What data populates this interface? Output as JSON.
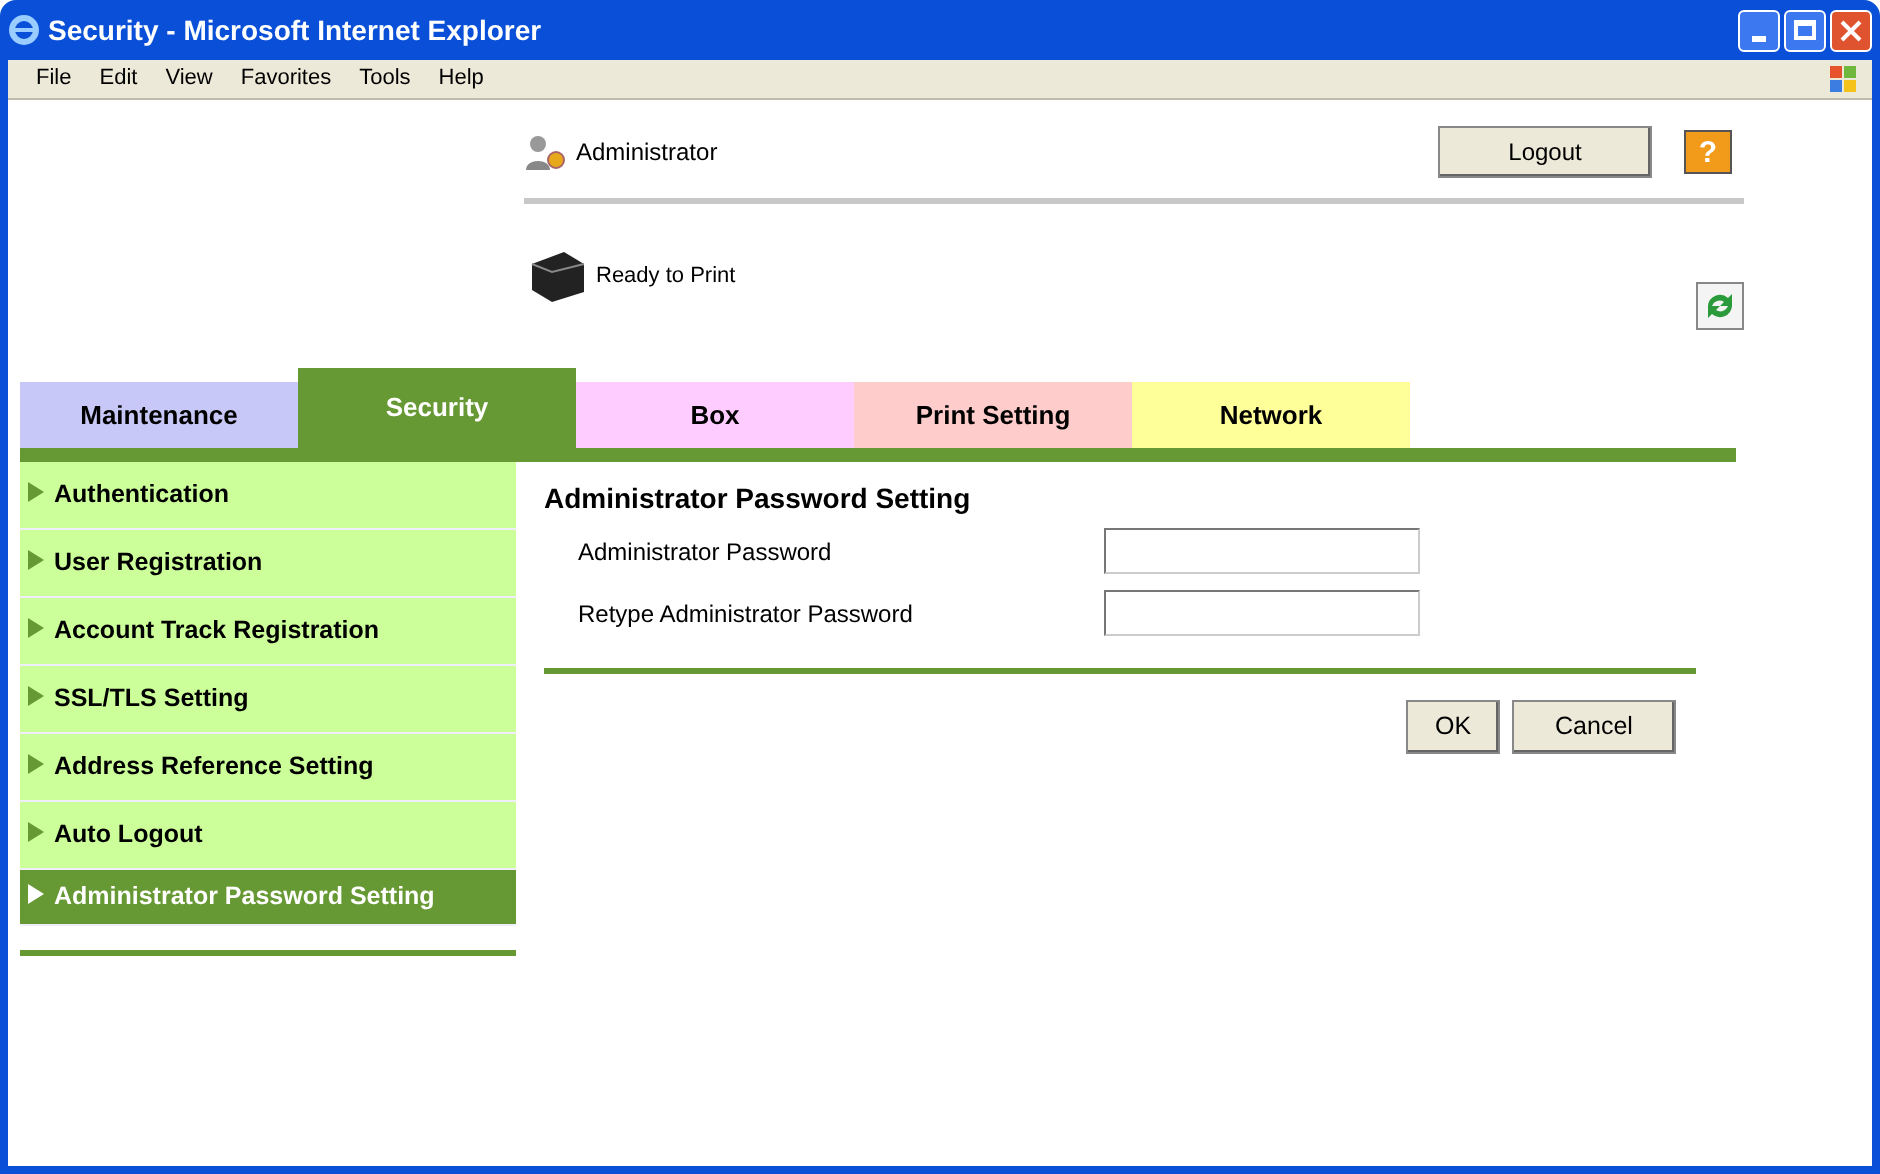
{
  "window": {
    "title": "Security - Microsoft Internet Explorer"
  },
  "menu": [
    "File",
    "Edit",
    "View",
    "Favorites",
    "Tools",
    "Help"
  ],
  "header": {
    "user": "Administrator",
    "logout": "Logout",
    "help": "?",
    "status": "Ready to Print"
  },
  "tabs": [
    {
      "label": "Maintenance",
      "selected": false,
      "color": "#c8c8f8"
    },
    {
      "label": "Security",
      "selected": true,
      "color": "#669933"
    },
    {
      "label": "Box",
      "selected": false,
      "color": "#ffccff"
    },
    {
      "label": "Print Setting",
      "selected": false,
      "color": "#ffcccc"
    },
    {
      "label": "Network",
      "selected": false,
      "color": "#ffff99"
    }
  ],
  "sidebar": {
    "items": [
      {
        "label": "Authentication",
        "selected": false
      },
      {
        "label": "User Registration",
        "selected": false
      },
      {
        "label": "Account Track Registration",
        "selected": false
      },
      {
        "label": "SSL/TLS Setting",
        "selected": false
      },
      {
        "label": "Address Reference Setting",
        "selected": false
      },
      {
        "label": "Auto Logout",
        "selected": false
      },
      {
        "label": "Administrator Password Setting",
        "selected": true
      }
    ]
  },
  "form": {
    "title": "Administrator Password Setting",
    "fields": [
      {
        "label": "Administrator Password"
      },
      {
        "label": "Retype Administrator Password"
      }
    ],
    "buttons": [
      "OK",
      "Cancel"
    ]
  }
}
